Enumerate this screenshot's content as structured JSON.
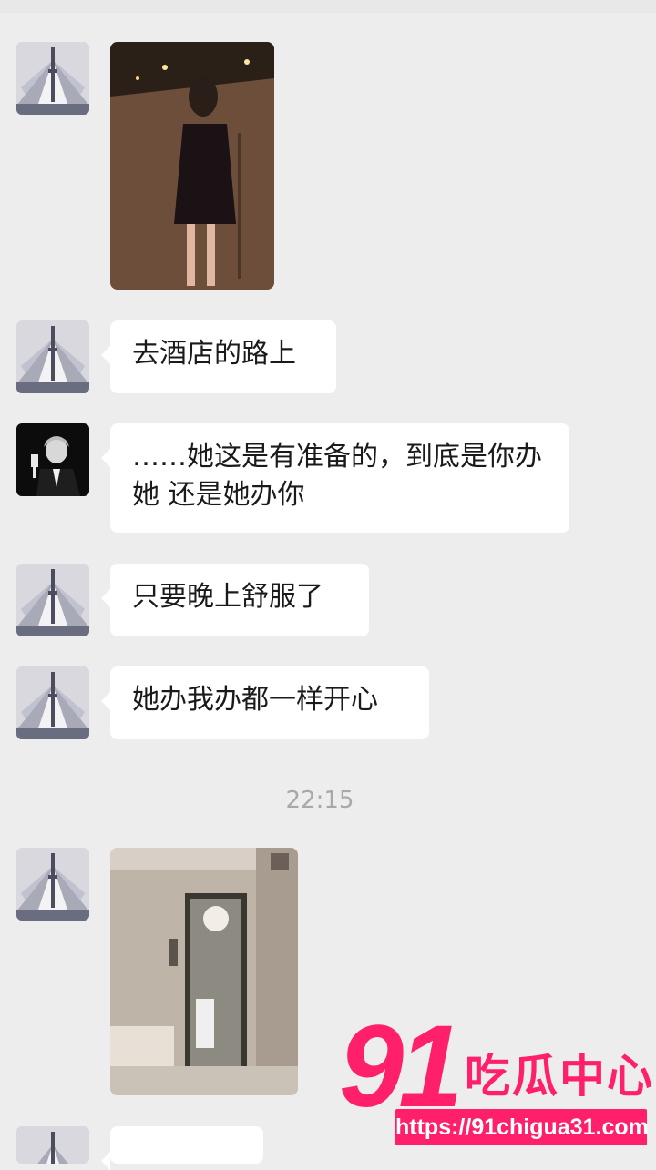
{
  "messages": [
    {
      "type": "image",
      "sender": "tower",
      "image_desc": "woman in black dress walking on a street at night"
    },
    {
      "type": "text",
      "sender": "tower",
      "text": "去酒店的路上"
    },
    {
      "type": "text",
      "sender": "man",
      "text": "……她这是有准备的，到底是你办她 还是她办你"
    },
    {
      "type": "text",
      "sender": "tower",
      "text": "只要晚上舒服了"
    },
    {
      "type": "text",
      "sender": "tower",
      "text": "她办我办都一样开心"
    },
    {
      "type": "timestamp",
      "text": "22:15"
    },
    {
      "type": "image",
      "sender": "tower",
      "image_desc": "hotel bathroom with glass door"
    },
    {
      "type": "text",
      "sender": "tower",
      "text": ""
    }
  ],
  "watermark": {
    "number": "91",
    "name": "吃瓜中心",
    "url": "https://91chigua31.com",
    "color": "#ff1f6b"
  },
  "colors": {
    "background": "#ededed",
    "bubble": "#ffffff",
    "text": "#1a1a1a",
    "timestamp": "#a8a8a8"
  },
  "icons": {
    "tower_avatar": "tv-tower-night-avatar",
    "man_avatar": "man-raising-glass-avatar"
  }
}
